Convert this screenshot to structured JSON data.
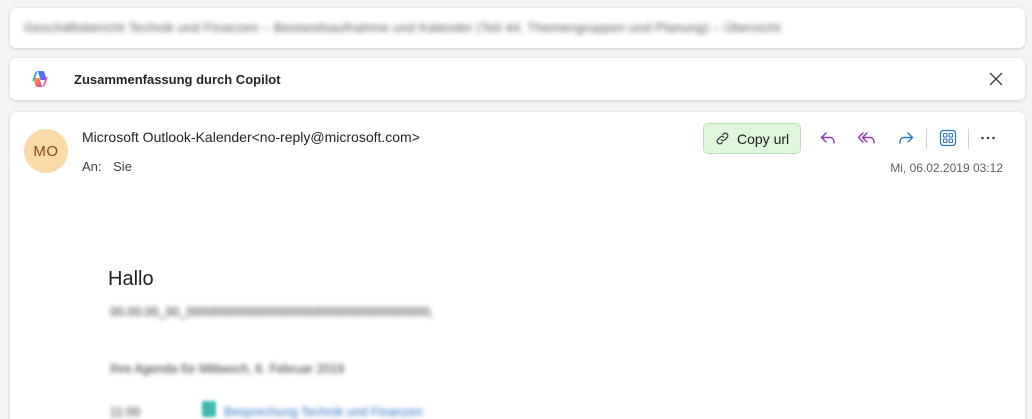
{
  "subject_bar": {
    "text": "Geschäftsbericht Technik und Finanzen – Bestandsaufnahme und Kalender (Teil 44, Themengruppen und Planung) – Übersicht"
  },
  "copilot_bar": {
    "logo_icon": "copilot-logo-icon",
    "label": "Zusammenfassung durch Copilot",
    "close_icon": "close-icon"
  },
  "message": {
    "avatar_initials": "MO",
    "avatar_color": "#fcd9a8",
    "sender": "Microsoft Outlook-Kalender<no-reply@microsoft.com>",
    "to_label": "An:",
    "to_value": "Sie",
    "date": "Mi, 06.02.2019 03:12",
    "toolbar": {
      "copy_url_label": "Copy url",
      "copy_url_icon": "link-icon",
      "copy_url_color": "#dff6dd",
      "reply_icon": "reply-icon",
      "reply_all_icon": "reply-all-icon",
      "forward_icon": "forward-icon",
      "apps_icon": "apps-icon",
      "more_icon": "more-icon",
      "reply_color": "#8a3ba8",
      "forward_color": "#2f74c7"
    },
    "body": {
      "greeting": "Hallo",
      "line1": "00.00.00_00_00000000000000000000000000000000000,",
      "line2": "Ihre Agenda für Mittwoch, 6. Februar 2019",
      "line3_label": "11:00",
      "line3_link": "Besprechung Technik und Finanzen"
    }
  }
}
